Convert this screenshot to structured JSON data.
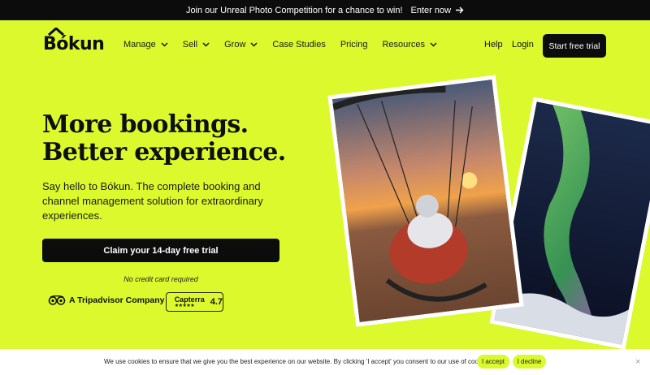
{
  "promo": {
    "text": "Join our Unreal Photo Competition for a chance to win!",
    "link": "Enter now"
  },
  "logo": {
    "text": "Bókun"
  },
  "nav": {
    "items": [
      {
        "label": "Manage",
        "has_dropdown": true
      },
      {
        "label": "Sell",
        "has_dropdown": true
      },
      {
        "label": "Grow",
        "has_dropdown": true
      },
      {
        "label": "Case Studies",
        "has_dropdown": false
      },
      {
        "label": "Pricing",
        "has_dropdown": false
      },
      {
        "label": "Resources",
        "has_dropdown": true
      }
    ],
    "help": "Help",
    "login": "Login",
    "cta": "Start free trial"
  },
  "hero": {
    "headline_line1": "More bookings.",
    "headline_line2": "Better experience.",
    "subtitle": "Say hello to Bókun. The complete booking and channel management solution for extraordinary experiences.",
    "cta": "Claim your 14-day free trial",
    "note": "No credit card required"
  },
  "badges": {
    "tripadvisor": "A Tripadvisor Company",
    "capterra_name": "Capterra",
    "capterra_stars": "★★★★★",
    "capterra_score": "4.7"
  },
  "cookie": {
    "text": "We use cookies to ensure that we give you the best experience on our website. By clicking 'I accept' you consent to our use of cookies.",
    "accept": "I accept",
    "decline": "I decline",
    "close": "×"
  },
  "colors": {
    "brand": "#dbf92c",
    "dark": "#0c0c0c"
  },
  "icons": [
    "arrow-right-icon",
    "chevron-down-icon",
    "tripadvisor-owl-icon",
    "capterra-flag-icon",
    "close-icon"
  ]
}
